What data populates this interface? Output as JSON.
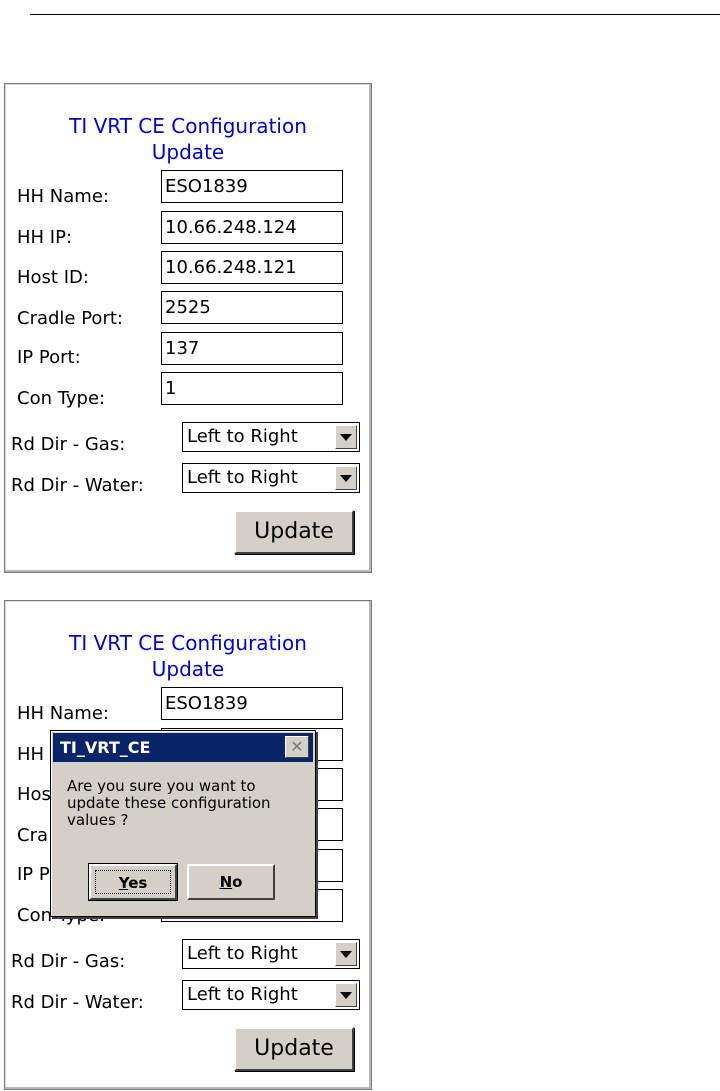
{
  "screen1": {
    "title_line1": "TI VRT CE Configuration",
    "title_line2": "Update",
    "labels": {
      "hh_name": "HH Name:",
      "hh_ip": "HH IP:",
      "host_id": "Host ID:",
      "cradle_port": "Cradle Port:",
      "ip_port": "IP Port:",
      "con_type": "Con Type:",
      "rd_dir_gas": "Rd Dir - Gas:",
      "rd_dir_water": "Rd Dir - Water:"
    },
    "values": {
      "hh_name": "ESO1839",
      "hh_ip": "10.66.248.124",
      "host_id": "10.66.248.121",
      "cradle_port": "2525",
      "ip_port": "137",
      "con_type": "1",
      "rd_dir_gas": "Left to Right",
      "rd_dir_water": "Left to Right"
    },
    "update_label": "Update"
  },
  "screen2": {
    "title_line1": "TI VRT CE Configuration",
    "title_line2": "Update",
    "labels": {
      "hh_name": "HH Name:",
      "hh_ip_partial": "HH",
      "host_id_partial": "Hos",
      "cradle_port_partial": "Cra",
      "ip_port_partial": "IP P",
      "con_type_partial": "Con Type:",
      "rd_dir_gas": "Rd Dir - Gas:",
      "rd_dir_water": "Rd Dir - Water:"
    },
    "values": {
      "hh_name": "ESO1839",
      "rd_dir_gas": "Left to Right",
      "rd_dir_water": "Left to Right"
    },
    "update_label": "Update",
    "dialog": {
      "title": "TI_VRT_CE",
      "close_icon": "close-icon",
      "message": "Are you sure you want to update these configuration values ?",
      "yes_mnemonic": "Y",
      "yes_rest": "es",
      "no_mnemonic": "N",
      "no_rest": "o"
    }
  },
  "colors": {
    "title_blue": "#0000cc",
    "dialog_titlebar": "#0a246a",
    "button_face": "#d4d0c8"
  }
}
